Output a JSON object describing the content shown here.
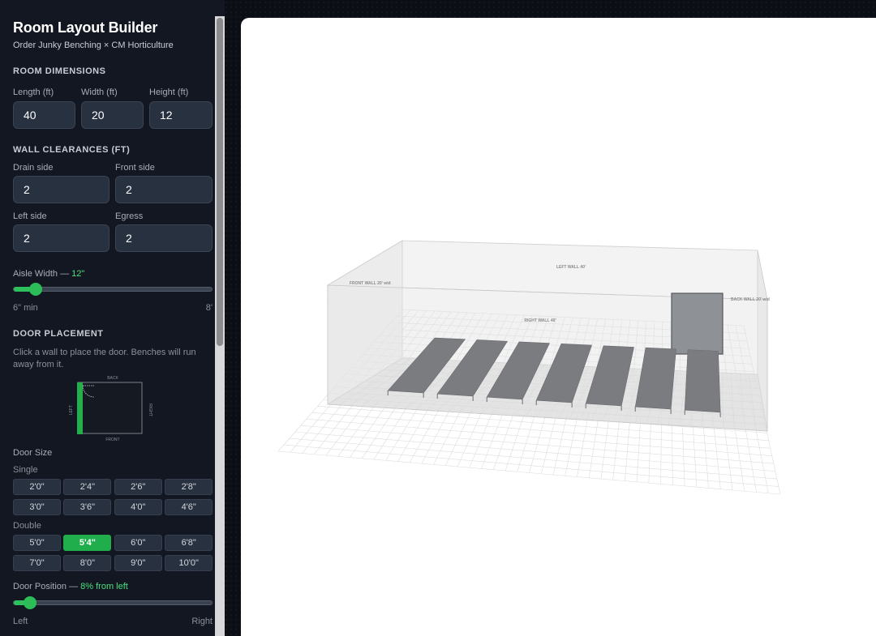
{
  "app": {
    "title": "Room Layout Builder",
    "subtitle": "Order Junky Benching × CM Horticulture"
  },
  "room": {
    "heading": "ROOM DIMENSIONS",
    "length_label": "Length (ft)",
    "length": "40",
    "width_label": "Width (ft)",
    "width": "20",
    "height_label": "Height (ft)",
    "height": "12"
  },
  "clearances": {
    "heading": "WALL CLEARANCES (FT)",
    "drain_label": "Drain side",
    "drain": "2",
    "front_label": "Front side",
    "front": "2",
    "left_label": "Left side",
    "left": "2",
    "egress_label": "Egress",
    "egress": "2"
  },
  "aisle": {
    "label": "Aisle Width — ",
    "value_label": "12\"",
    "value_fraction": 0.11,
    "min_label": "6\" min",
    "max_label": "8'"
  },
  "door": {
    "heading": "DOOR PLACEMENT",
    "help": "Click a wall to place the door. Benches will run away from it.",
    "map": {
      "back": "BACK",
      "front": "FRONT",
      "left": "LEFT",
      "right": "RIGHT"
    },
    "size_label": "Door Size",
    "single_label": "Single",
    "single_sizes": [
      "2'0\"",
      "2'4\"",
      "2'6\"",
      "2'8\"",
      "3'0\"",
      "3'6\"",
      "4'0\"",
      "4'6\""
    ],
    "double_label": "Double",
    "double_sizes": [
      "5'0\"",
      "5'4\"",
      "6'0\"",
      "6'8\"",
      "7'0\"",
      "8'0\"",
      "9'0\"",
      "10'0\""
    ],
    "selected_size": "5'4\"",
    "position_label": "Door Position — ",
    "position_value": "8% from left",
    "position_fraction": 0.08,
    "position_min": "Left",
    "position_max": "Right"
  },
  "scene": {
    "left_wall": "LEFT WALL 40'",
    "right_wall": "RIGHT WALL 40'",
    "front_wall": "FRONT WALL 20' wid",
    "back_wall": "BACK WALL 20' wid",
    "bench_count": 7
  },
  "colors": {
    "accent": "#2ec05c",
    "selected_button": "#1fae4b",
    "sidebar_bg": "#121722",
    "input_bg": "#283140"
  }
}
